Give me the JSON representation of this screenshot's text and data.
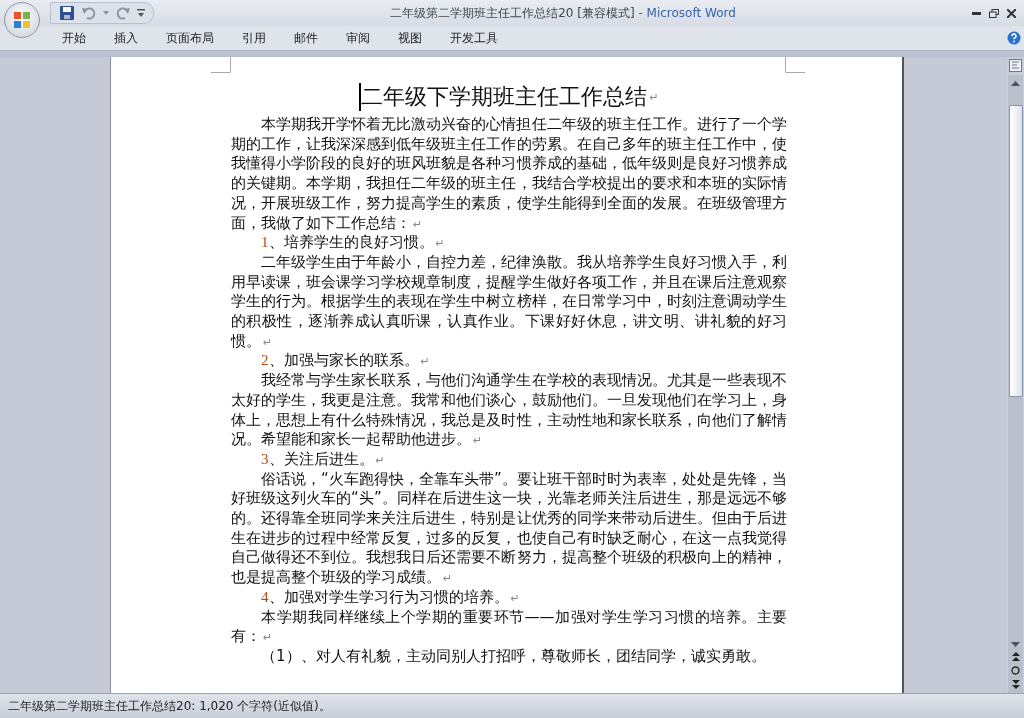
{
  "window": {
    "title": "二年级第二学期班主任工作总结20 [兼容模式]",
    "app_name": " - Microsoft Word"
  },
  "ribbon_tabs": [
    {
      "label": "开始",
      "selected": false
    },
    {
      "label": "插入",
      "selected": false
    },
    {
      "label": "页面布局",
      "selected": false
    },
    {
      "label": "引用",
      "selected": false
    },
    {
      "label": "邮件",
      "selected": false
    },
    {
      "label": "审阅",
      "selected": false
    },
    {
      "label": "视图",
      "selected": false
    },
    {
      "label": "开发工具",
      "selected": false
    }
  ],
  "document": {
    "paragraphs": [
      {
        "kind": "heading",
        "text": "二年级下学期班主任工作总结",
        "mark": "↵"
      },
      {
        "kind": "body",
        "text": "本学期我开学怀着无比激动兴奋的心情担任二年级的班主任工作。进行了一个学期的工作，让我深深感到低年级班主任工作的劳累。在自己多年的班主任工作中，使我懂得小学阶段的良好的班风班貌是各种习惯养成的基础，低年级则是良好习惯养成的关键期。本学期，我担任二年级的班主任，我结合学校提出的要求和本班的实际情况，开展班级工作，努力提高学生的素质，使学生能得到全面的发展。在班级管理方面，我做了如下工作总结：",
        "mark": "↵"
      },
      {
        "kind": "item",
        "number": "1",
        "text": "、培养学生的良好习惯。",
        "mark": "↵"
      },
      {
        "kind": "body",
        "text": "二年级学生由于年龄小，自控力差，纪律涣散。我从培养学生良好习惯入手，利用早读课，班会课学习学校规章制度，提醒学生做好各项工作，并且在课后注意观察学生的行为。根据学生的表现在学生中树立榜样，在日常学习中，时刻注意调动学生的积极性，逐渐养成认真听课，认真作业。下课好好休息，讲文明、讲礼貌的好习惯。",
        "mark": "↵"
      },
      {
        "kind": "item",
        "number": "2",
        "text": "、加强与家长的联系。",
        "mark": "↵"
      },
      {
        "kind": "body",
        "text": "我经常与学生家长联系，与他们沟通学生在学校的表现情况。尤其是一些表现不太好的学生，我更是注意。我常和他们谈心，鼓励他们。一旦发现他们在学习上，身体上，思想上有什么特殊情况，我总是及时性，主动性地和家长联系，向他们了解情况。希望能和家长一起帮助他进步。",
        "mark": "↵"
      },
      {
        "kind": "item",
        "number": "3",
        "text": "、关注后进生。",
        "mark": "↵"
      },
      {
        "kind": "body",
        "text": "俗话说，“火车跑得快，全靠车头带”。要让班干部时时为表率，处处是先锋，当好班级这列火车的“头”。同样在后进生这一块，光靠老师关注后进生，那是远远不够的。还得靠全班同学来关注后进生，特别是让优秀的同学来带动后进生。但由于后进生在进步的过程中经常反复，过多的反复，也使自己有时缺乏耐心，在这一点我觉得自己做得还不到位。我想我日后还需要不断努力，提高整个班级的积极向上的精神，也是提高整个班级的学习成绩。",
        "mark": "↵"
      },
      {
        "kind": "item",
        "number": "4",
        "text": "、加强对学生学习行为习惯的培养。",
        "mark": "↵"
      },
      {
        "kind": "body",
        "text": "本学期我同样继续上个学期的重要环节——加强对学生学习习惯的培养。主要有：",
        "mark": "↵"
      },
      {
        "kind": "body",
        "text": "（1）、对人有礼貌，主动同别人打招呼，尊敬师长，团结同学，诚实勇敢。"
      }
    ]
  },
  "status_bar": {
    "text": "二年级第二学期班主任工作总结20: 1,020 个字符(近似值)。"
  }
}
